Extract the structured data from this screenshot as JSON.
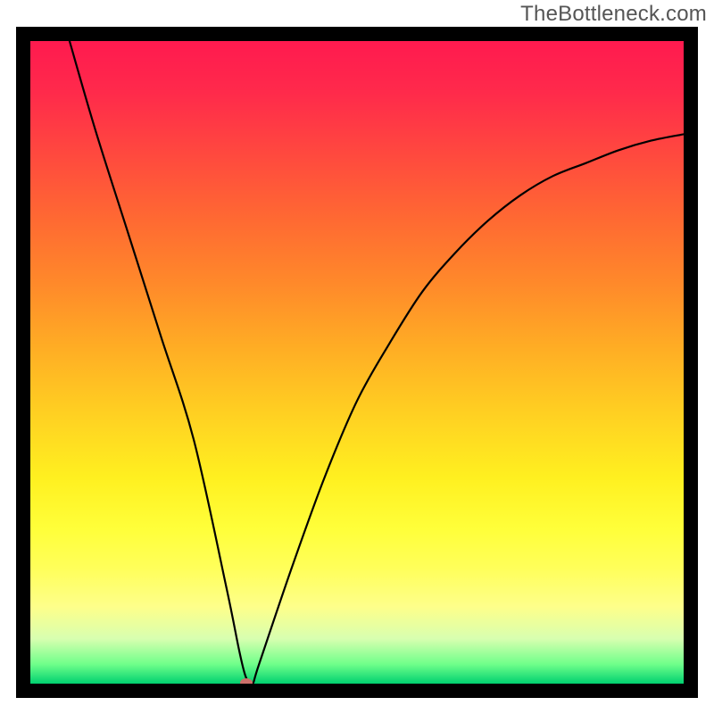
{
  "watermark": "TheBottleneck.com",
  "chart_data": {
    "type": "line",
    "title": "",
    "xlabel": "",
    "ylabel": "",
    "xlim": [
      0,
      100
    ],
    "ylim": [
      0,
      100
    ],
    "series": [
      {
        "name": "curve",
        "x": [
          6,
          10,
          15,
          20,
          25,
          30,
          32,
          33,
          34,
          35,
          40,
          45,
          50,
          55,
          60,
          65,
          70,
          75,
          80,
          85,
          90,
          95,
          100
        ],
        "y": [
          100,
          86,
          70,
          54,
          38,
          15,
          5,
          1,
          0,
          3,
          18,
          32,
          44,
          53,
          61,
          67,
          72,
          76,
          79,
          81,
          83,
          84.5,
          85.5
        ]
      }
    ],
    "marker": {
      "x": 33,
      "y": 0,
      "color": "#cc6f6a"
    },
    "background_gradient": {
      "top": "#ff1a4f",
      "mid": "#ffd022",
      "bottom": "#00d070"
    }
  }
}
